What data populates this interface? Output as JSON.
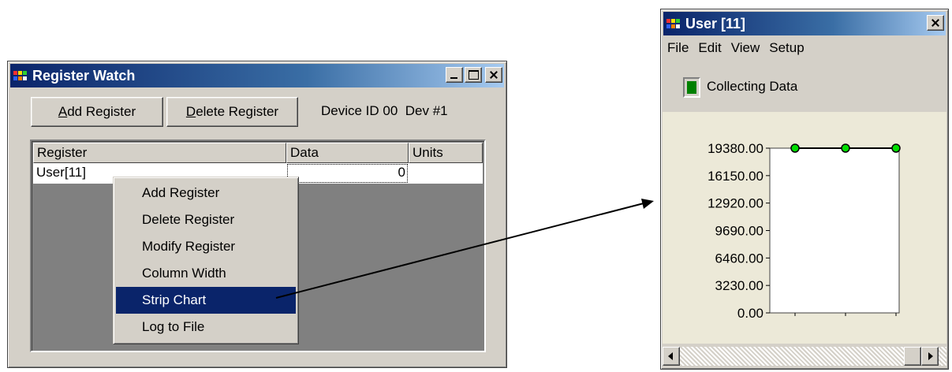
{
  "register_watch": {
    "title": "Register Watch",
    "buttons": {
      "add_register": {
        "mnemonic": "A",
        "rest": "dd Register"
      },
      "delete_register": {
        "mnemonic": "D",
        "rest": "elete Register"
      }
    },
    "device_info": "Device ID 00  Dev #1",
    "columns": [
      "Register",
      "Data",
      "Units"
    ],
    "rows": [
      {
        "register": "User[11]",
        "data": "0",
        "units": ""
      }
    ]
  },
  "context_menu": {
    "items": [
      "Add Register",
      "Delete Register",
      "Modify Register",
      "Column Width",
      "Strip Chart",
      "Log to File"
    ],
    "selected_index": 4
  },
  "strip_chart": {
    "title": "User [11]",
    "menu": [
      "File",
      "Edit",
      "View",
      "Setup"
    ],
    "status_label": "Collecting Data",
    "status_color": "#008000",
    "point_color": "#00dd00"
  },
  "chart_data": {
    "type": "line",
    "x": [
      1,
      2,
      3
    ],
    "series": [
      {
        "values": [
          19380,
          19380,
          19380
        ]
      }
    ],
    "yticks": [
      "19380.00",
      "16150.00",
      "12920.00",
      "9690.00",
      "6460.00",
      "3230.00",
      "0.00"
    ],
    "ylim": [
      0,
      19380
    ],
    "title": "",
    "xlabel": "",
    "ylabel": ""
  }
}
